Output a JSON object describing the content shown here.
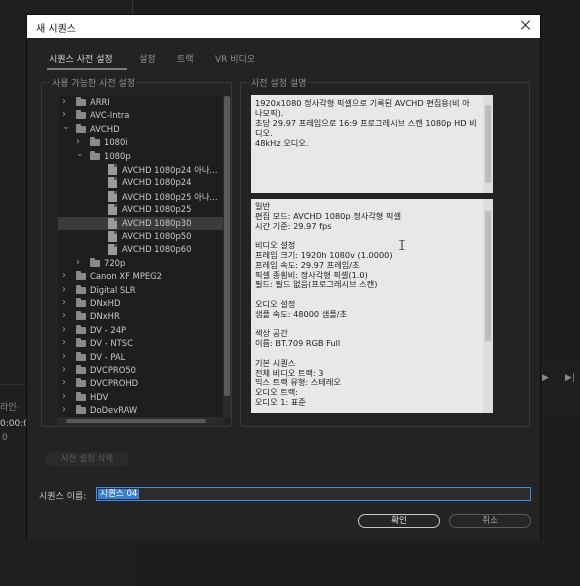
{
  "background": {
    "left_text_1": "라인·",
    "left_text_2": "0:00:0",
    "left_text_3": "0"
  },
  "dialog": {
    "title": "새 시퀀스",
    "tabs": [
      "시퀀스 사전 설정",
      "설정",
      "트랙",
      "VR 비디오"
    ],
    "active_tab": 0,
    "presets_group_label": "사용 가능한 사전 설정",
    "description_group_label": "사전 설정 설명",
    "tree": [
      {
        "indent": 0,
        "expanded": false,
        "type": "folder",
        "label": "ARRI"
      },
      {
        "indent": 0,
        "expanded": false,
        "type": "folder",
        "label": "AVC-Intra"
      },
      {
        "indent": 0,
        "expanded": true,
        "type": "folder",
        "label": "AVCHD"
      },
      {
        "indent": 1,
        "expanded": false,
        "type": "folder",
        "label": "1080i"
      },
      {
        "indent": 1,
        "expanded": true,
        "type": "folder",
        "label": "1080p"
      },
      {
        "indent": 2,
        "type": "file",
        "label": "AVCHD 1080p24 아나..."
      },
      {
        "indent": 2,
        "type": "file",
        "label": "AVCHD 1080p24"
      },
      {
        "indent": 2,
        "type": "file",
        "label": "AVCHD 1080p25 아나..."
      },
      {
        "indent": 2,
        "type": "file",
        "label": "AVCHD 1080p25"
      },
      {
        "indent": 2,
        "type": "file",
        "label": "AVCHD 1080p30",
        "selected": true
      },
      {
        "indent": 2,
        "type": "file",
        "label": "AVCHD 1080p50"
      },
      {
        "indent": 2,
        "type": "file",
        "label": "AVCHD 1080p60"
      },
      {
        "indent": 1,
        "expanded": false,
        "type": "folder",
        "label": "720p"
      },
      {
        "indent": 0,
        "expanded": false,
        "type": "folder",
        "label": "Canon XF MPEG2"
      },
      {
        "indent": 0,
        "expanded": false,
        "type": "folder",
        "label": "Digital SLR"
      },
      {
        "indent": 0,
        "expanded": false,
        "type": "folder",
        "label": "DNxHD"
      },
      {
        "indent": 0,
        "expanded": false,
        "type": "folder",
        "label": "DNxHR"
      },
      {
        "indent": 0,
        "expanded": false,
        "type": "folder",
        "label": "DV - 24P"
      },
      {
        "indent": 0,
        "expanded": false,
        "type": "folder",
        "label": "DV - NTSC"
      },
      {
        "indent": 0,
        "expanded": false,
        "type": "folder",
        "label": "DV - PAL"
      },
      {
        "indent": 0,
        "expanded": false,
        "type": "folder",
        "label": "DVCPRO50"
      },
      {
        "indent": 0,
        "expanded": false,
        "type": "folder",
        "label": "DVCPROHD"
      },
      {
        "indent": 0,
        "expanded": false,
        "type": "folder",
        "label": "HDV"
      },
      {
        "indent": 0,
        "expanded": false,
        "type": "folder",
        "label": "DoDevRAW"
      }
    ],
    "description_top": [
      "1920x1080 정사각형 픽셀으로 기록된 AVCHD 편집용(비 아",
      "나모픽).",
      "초당 29.97 프레임으로 16:9 프로그레시브 스캔 1080p HD 비",
      "디오.",
      "48kHz 오디오."
    ],
    "description_bottom": [
      "일반",
      " 편집 모드: AVCHD 1080p 정사각형 픽셀",
      " 시간 기준: 29.97 fps",
      "",
      "비디오 설정",
      " 프레임 크기: 1920h 1080v (1.0000)",
      " 프레임 속도: 29.97 프레임/초",
      " 픽셀 종횡비: 정사각형 픽셀(1.0)",
      " 필드: 필드 없음(프로그레시브 스캔)",
      "",
      "오디오 설정",
      " 샘플 속도: 48000 샘플/초",
      "",
      "색상 공간",
      " 이름: BT.709 RGB Full",
      "",
      "기본 시퀀스",
      " 전체 비디오 트랙: 3",
      " 믹스 트랙 유형: 스테레오",
      " 오디오 트랙:",
      " 오디오 1: 표준"
    ],
    "delete_preset_label": "사전 설정 삭제",
    "sequence_name_label": "시퀀스 이름:",
    "sequence_name_value": "시퀀스 04",
    "ok_label": "확인",
    "cancel_label": "취소"
  },
  "colors": {
    "selection": "#3b7fd1",
    "dialog_bg": "#232323"
  }
}
